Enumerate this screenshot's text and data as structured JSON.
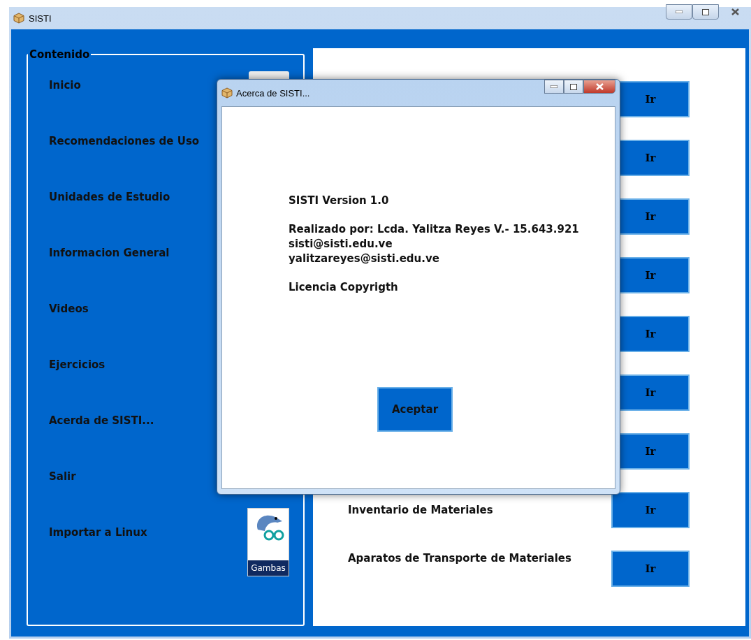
{
  "window": {
    "title": "SISTI"
  },
  "sidebar": {
    "title": "Contenido",
    "items": [
      {
        "label": "Inicio"
      },
      {
        "label": "Recomendaciones de Uso"
      },
      {
        "label": "Unidades de Estudio"
      },
      {
        "label": "Informacion General"
      },
      {
        "label": "Videos"
      },
      {
        "label": "Ejercicios"
      },
      {
        "label": "Acerda de SISTI..."
      },
      {
        "label": "Salir"
      },
      {
        "label": "Importar a Linux",
        "icon_text": "Gambas"
      }
    ]
  },
  "content": {
    "rows": [
      {
        "button": "Ir"
      },
      {
        "button": "Ir"
      },
      {
        "button": "Ir"
      },
      {
        "button": "Ir"
      },
      {
        "button": "Ir"
      },
      {
        "button": "Ir"
      },
      {
        "button": "Ir"
      },
      {
        "label": "Inventario de Materiales",
        "button": "Ir"
      },
      {
        "label": "Aparatos de Transporte de Materiales",
        "button": "Ir"
      }
    ]
  },
  "dialog": {
    "title": "Acerca de SISTI...",
    "paragraphs": [
      [
        "SISTI Version 1.0"
      ],
      [
        "Realizado por: Lcda. Yalitza Reyes V.- 15.643.921",
        "sisti@sisti.edu.ve",
        "yalitzareyes@sisti.edu.ve"
      ],
      [
        "Licencia Copyrigth"
      ]
    ],
    "button": "Aceptar"
  }
}
